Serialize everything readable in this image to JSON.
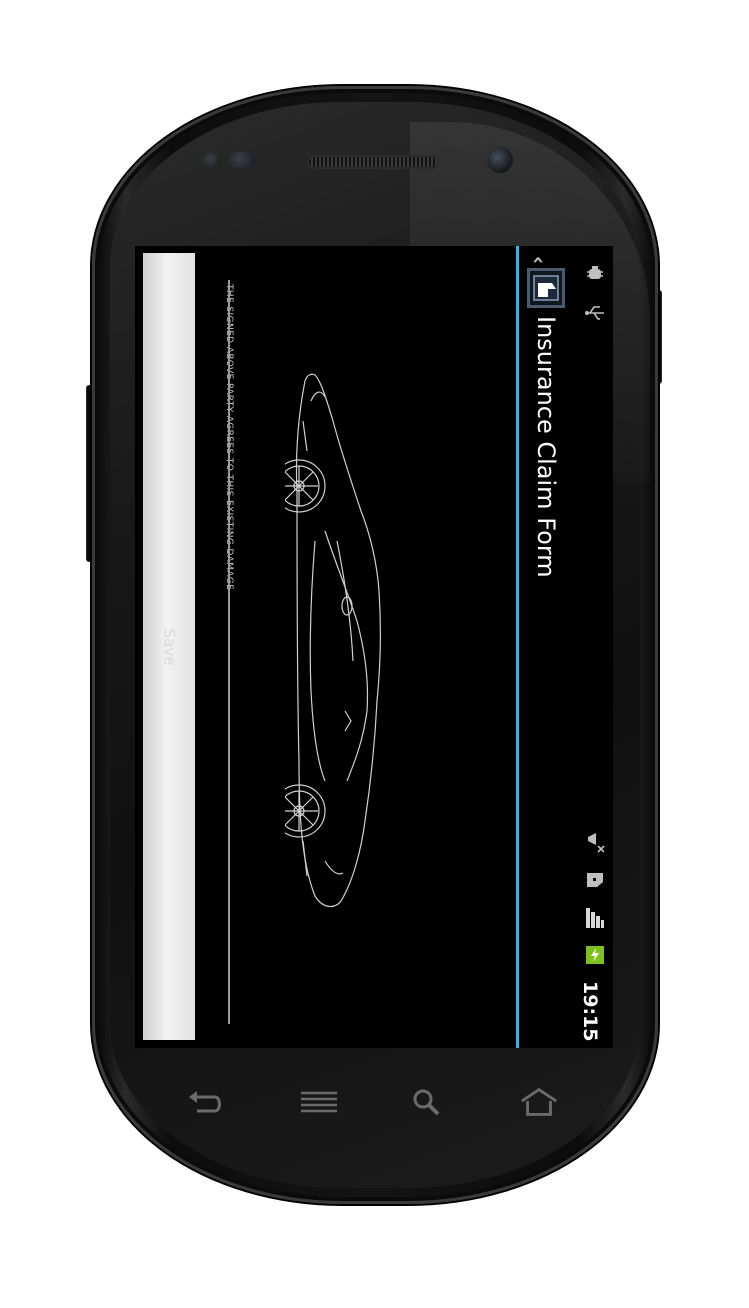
{
  "app": {
    "title": "Insurance Claim Form"
  },
  "status_bar": {
    "time": "19:15",
    "icons": [
      "android-debug-icon",
      "usb-icon",
      "silent-mode-icon",
      "notification-icon",
      "signal-icon",
      "battery-charging-icon"
    ],
    "battery_color": "#7fbf1e"
  },
  "signature": {
    "agreement_text": "THE SIGNED ABOVE PARTY AGREES TO THIS EXISTING DAMAGE",
    "save_label": "Save"
  },
  "nav_keys": [
    "back-icon",
    "menu-icon",
    "search-icon",
    "home-icon"
  ],
  "colors": {
    "accent": "#33b5e5",
    "screen_bg": "#000000"
  }
}
